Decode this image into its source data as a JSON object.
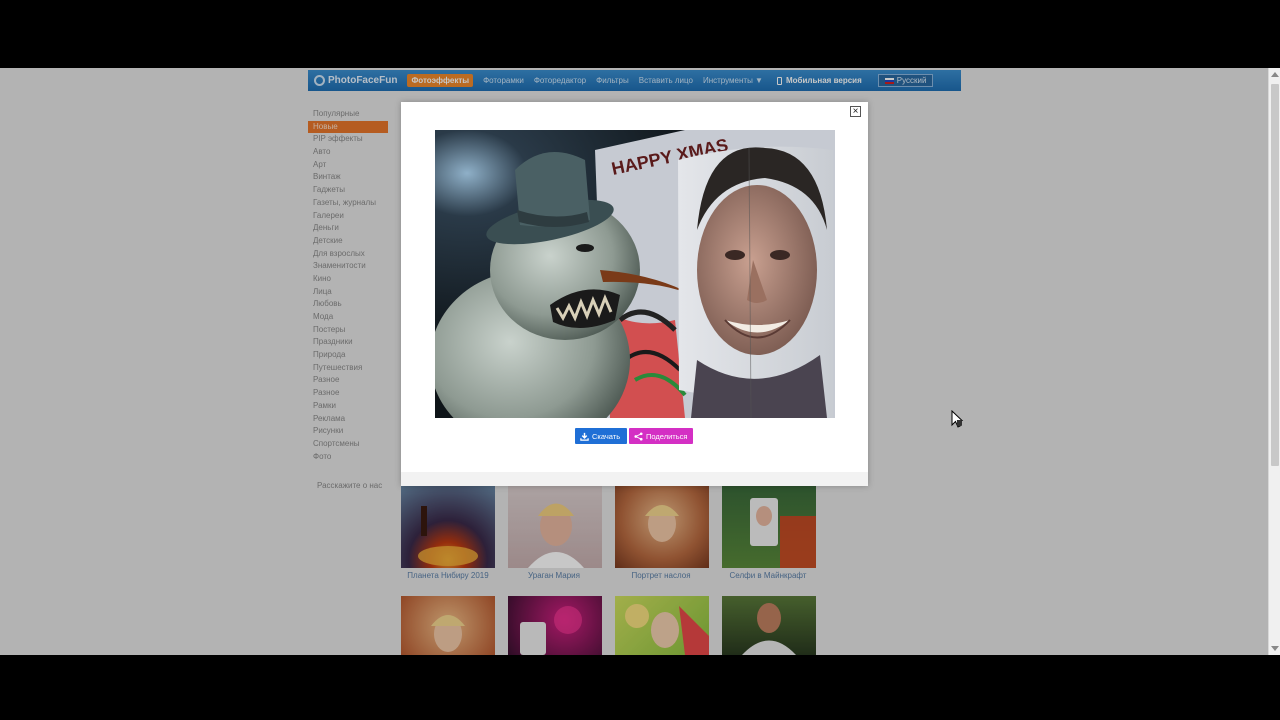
{
  "navbar": {
    "logo": "PhotoFaceFun",
    "items": [
      {
        "label": "Фотоэффекты",
        "active": true
      },
      {
        "label": "Фоторамки",
        "active": false
      },
      {
        "label": "Фоторедактор",
        "active": false
      },
      {
        "label": "Фильтры",
        "active": false
      },
      {
        "label": "Вставить лицо",
        "active": false
      },
      {
        "label": "Инструменты ▼",
        "active": false
      }
    ],
    "mobile": "Мобильная версия",
    "language": "Русский"
  },
  "sidebar": {
    "items": [
      "Популярные",
      "Новые",
      "PIP эффекты",
      "Авто",
      "Арт",
      "Винтаж",
      "Гаджеты",
      "Газеты, журналы",
      "Галереи",
      "Деньги",
      "Детские",
      "Для взрослых",
      "Знаменитости",
      "Кино",
      "Лица",
      "Любовь",
      "Мода",
      "Постеры",
      "Праздники",
      "Природа",
      "Путешествия",
      "Разное",
      "Разное",
      "Рамки",
      "Реклама",
      "Рисунки",
      "Спортсмены",
      "Фото"
    ],
    "active_index": 1,
    "footer": "Расскажите о нас"
  },
  "gallery": {
    "row1": [
      {
        "caption": "Планета Нибиру 2019"
      },
      {
        "caption": "Ураган Мария"
      },
      {
        "caption": "Портрет наслоя"
      },
      {
        "caption": "Селфи в Майнкрафт"
      }
    ]
  },
  "modal": {
    "close_label": "×",
    "preview_text": "HAPPY XMAS",
    "download_label": "Скачать",
    "share_label": "Поделиться"
  },
  "colors": {
    "nav_active": "#f08a2c",
    "sidebar_active": "#e8772b",
    "download": "#1f6fd6",
    "share": "#d42fc4"
  }
}
